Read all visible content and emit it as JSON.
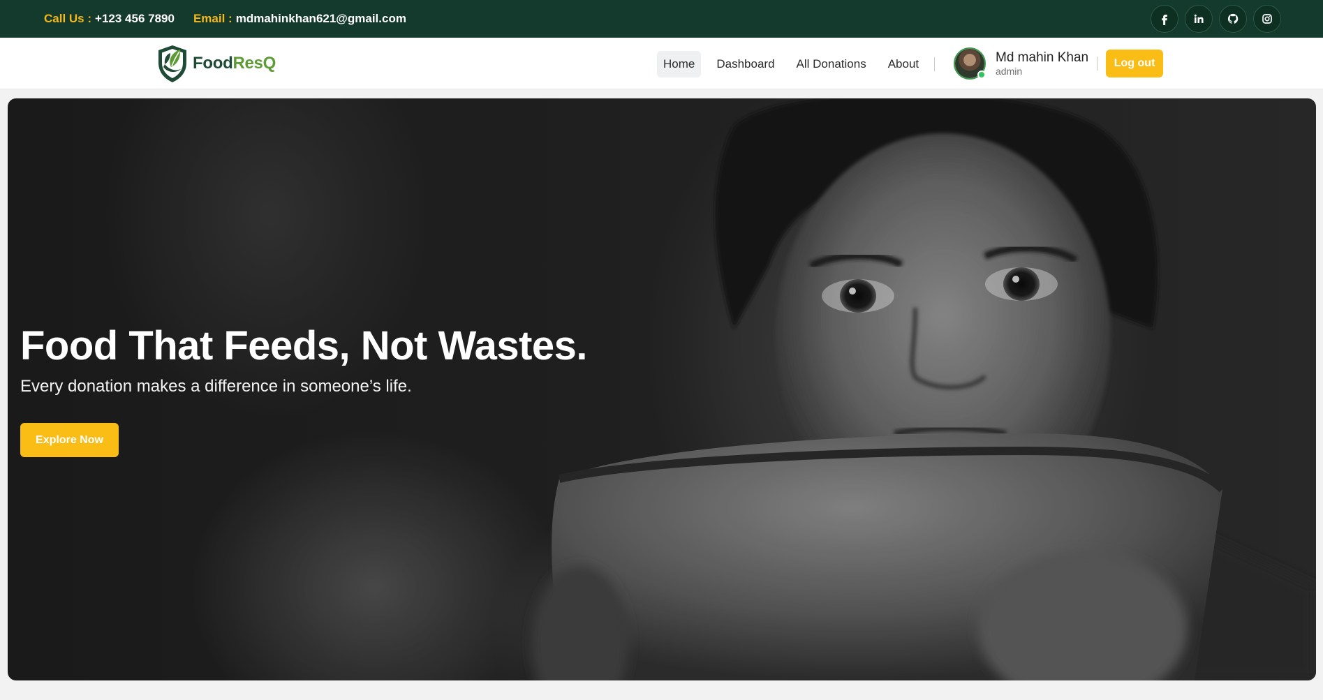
{
  "topbar": {
    "phone_label": "Call Us :",
    "phone_value": "+123 456 7890",
    "email_label": "Email :",
    "email_value": "mdmahinkhan621@gmail.com",
    "social_icons": [
      "facebook-icon",
      "linkedin-icon",
      "github-icon",
      "instagram-icon"
    ]
  },
  "brand": {
    "name_part1": "Food",
    "name_part2": "ResQ",
    "color_dark": "#1f4a35",
    "color_light": "#5c9b35"
  },
  "nav": {
    "items": [
      {
        "label": "Home",
        "active": true
      },
      {
        "label": "Dashboard",
        "active": false
      },
      {
        "label": "All Donations",
        "active": false
      },
      {
        "label": "About",
        "active": false
      }
    ]
  },
  "user": {
    "name": "Md mahin Khan",
    "role": "admin",
    "logout_label": "Log out"
  },
  "hero": {
    "title": "Food That Feeds, Not Wastes.",
    "subtitle": "Every donation makes a difference in someone’s life.",
    "cta_label": "Explore Now"
  },
  "colors": {
    "topbar_bg": "#133a2c",
    "accent_yellow": "#f9bd16",
    "online_green": "#31c45e"
  }
}
